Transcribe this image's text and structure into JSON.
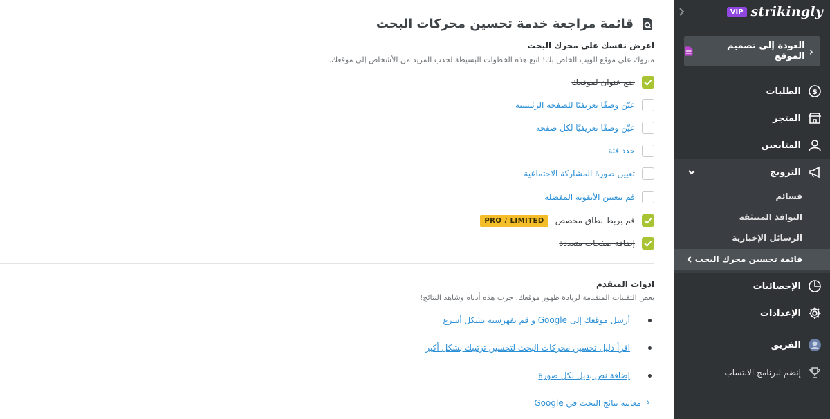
{
  "sidebar": {
    "logo_text": "strikingly",
    "vip_badge": "VIP",
    "back_button": "العودة إلى تصميم الموقع",
    "nav": {
      "orders": "الطلبات",
      "store": "المتجر",
      "followers": "المتابعين",
      "promotion": "الترويج",
      "stats": "الإحصائيات",
      "settings": "الإعدادات",
      "team": "الفريق",
      "affiliate": "إنضم لبرنامج الانتساب"
    },
    "promotion_sub": {
      "lists": "قسائم",
      "popups": "النوافذ المنبثقة",
      "newsletters": "الرسائل الإخبارية",
      "seo_checklist": "قائمة تحسين محرك البحث"
    }
  },
  "main": {
    "title": "قائمة مراجعة خدمة تحسين محركات البحث",
    "section1": {
      "heading": "اعرض نفسك على محرك البحث",
      "description": "مبروك على موقع الويب الخاص بك! اتبع هذه الخطوات البسيطة لجذب المزيد من الأشخاص إلى موقعك."
    },
    "checklist": [
      {
        "label": "ضع عنوان لموقعك",
        "checked": true
      },
      {
        "label": "عيّن وصفًا تعريفيًا للصفحة الرئيسية",
        "checked": false
      },
      {
        "label": "عيّن وصفًا تعريفيًا لكل صفحة",
        "checked": false
      },
      {
        "label": "حدد فئة",
        "checked": false
      },
      {
        "label": "تعيين صورة المشاركة الاجتماعية",
        "checked": false
      },
      {
        "label": "قم بتعيين الأيقونة المفضلة",
        "checked": false
      },
      {
        "label": "قم بربط نطاق مخصص",
        "checked": true
      },
      {
        "label": "إضافة صفحات متعددة",
        "checked": true
      }
    ],
    "pro_badge": "PRO / LIMITED",
    "section2": {
      "heading": "ادوات المتقدم",
      "description": "بعض التقنيات المتقدمة لزيادة ظهور موقعك. جرب هذه أدناه وشاهد النتائج!"
    },
    "advanced_links": [
      "أرسل موقعك إلى Google و قم بفهرسته بشكل أسرع",
      "اقرأ دليل تحسين محركات البحث لتحسين ترتيبك بشكل أكبر",
      "إضافة نص بديل لكل صورة"
    ],
    "preview_link": "معاينة نتائج البحث في Google"
  },
  "colors": {
    "sidebar_bg": "#2f3336",
    "check_green": "#a8c432",
    "link_blue": "#2b8fd6",
    "pro_yellow": "#f4be2a",
    "vip_purple": "#8f47e0"
  }
}
